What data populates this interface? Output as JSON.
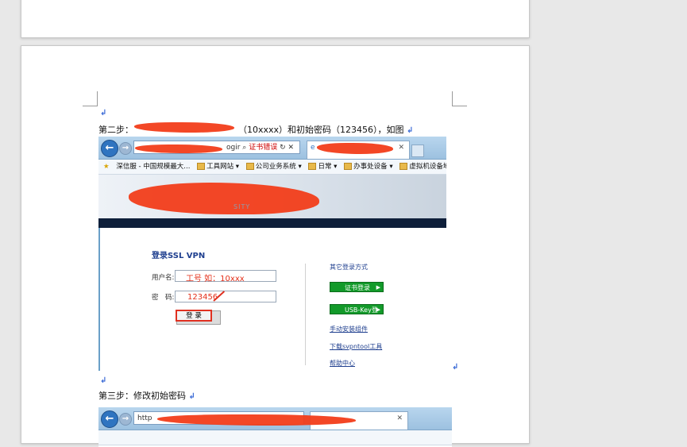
{
  "step2": {
    "prefix": "第二步：",
    "middle": "（10xxxx）和初始密码（123456），如图",
    "para_mark": "↲"
  },
  "step3": {
    "text": "第三步：修改初始密码",
    "para_mark": "↲"
  },
  "browser": {
    "address_suffix": "ogir",
    "cert_error": "证书错误",
    "favorites": [
      {
        "label": "深信服 - 中国规模最大..."
      },
      {
        "label": "工具网站 ▾"
      },
      {
        "label": "公司业务系统 ▾"
      },
      {
        "label": "日常 ▾"
      },
      {
        "label": "办事处设备 ▾"
      },
      {
        "label": "虚拟机设备地址 ▾"
      }
    ],
    "second_address": "http"
  },
  "login": {
    "title": "登录SSL VPN",
    "username_label": "用户名:",
    "password_label": "密　码:",
    "username_hint": "工号 如：10xxx",
    "password_hint": "123456",
    "login_button": "登 录",
    "other_methods_title": "其它登录方式",
    "cert_login": "证书登录",
    "usbkey_login": "USB-Key登录",
    "links": [
      "手动安装组件",
      "下载svpntool工具",
      "帮助中心"
    ]
  },
  "colors": {
    "redaction": "#f23d1a",
    "link": "#1f3f8f",
    "green_button": "#139a2a",
    "hint_red": "#e4301a"
  }
}
